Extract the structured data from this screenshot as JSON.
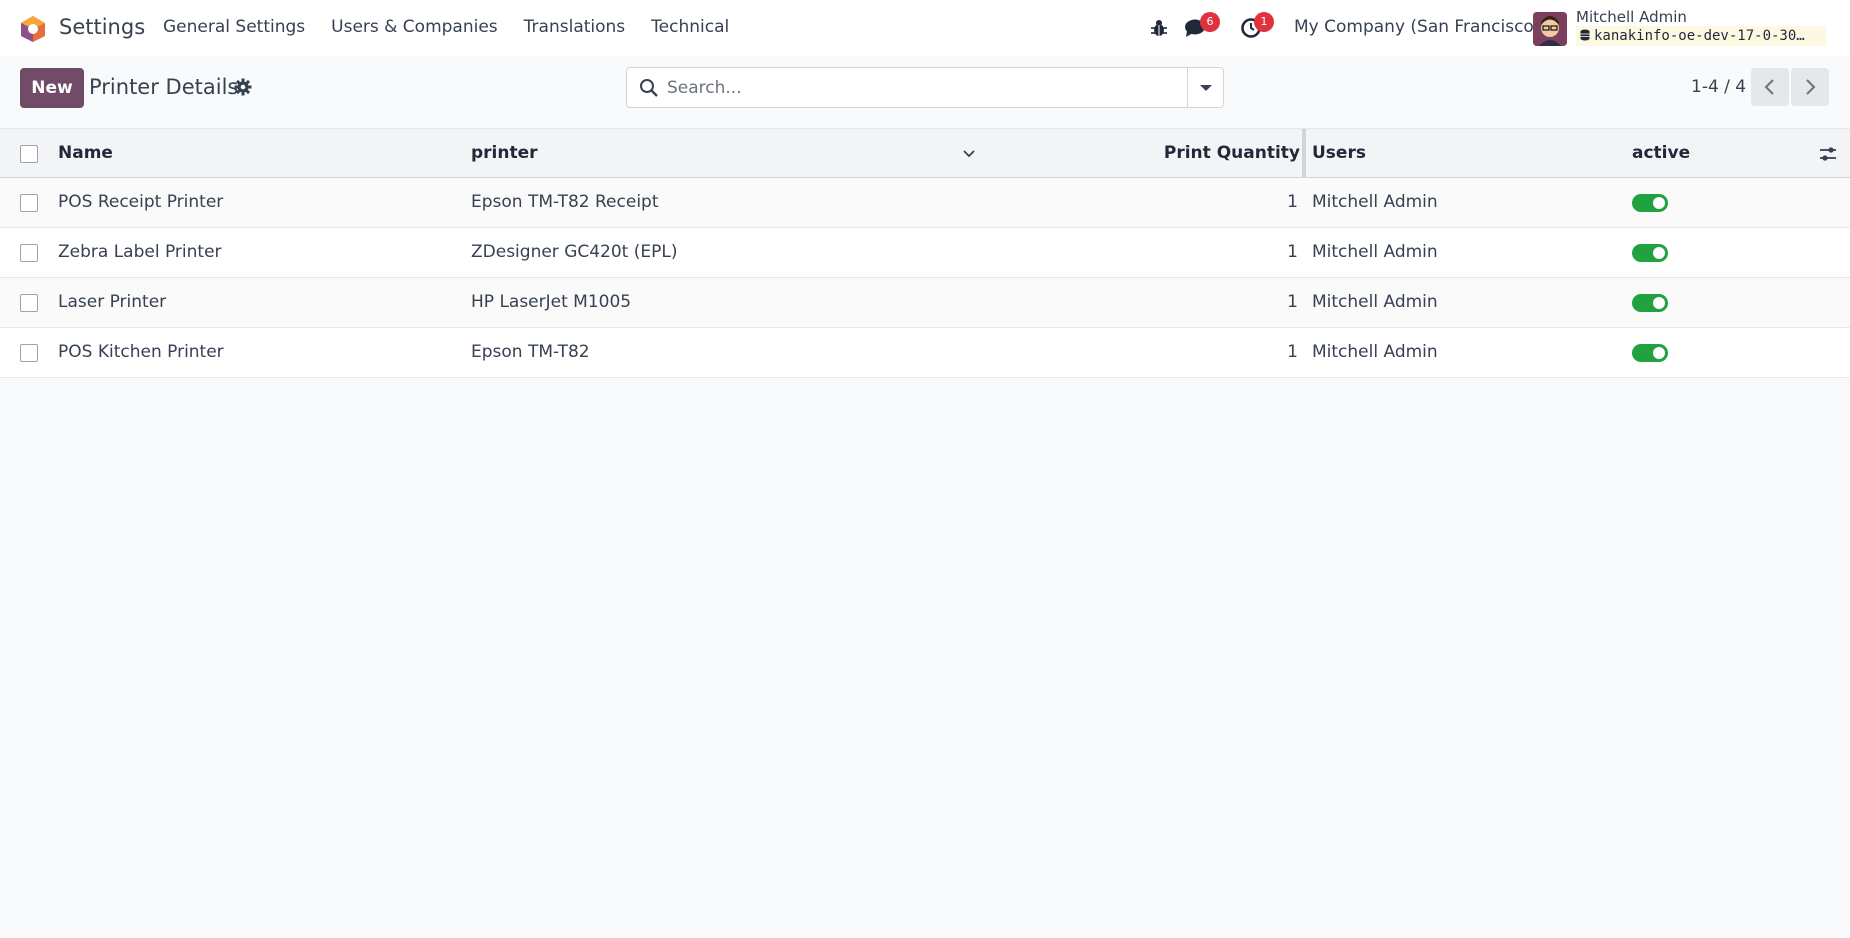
{
  "navbar": {
    "app_name": "Settings",
    "menu": [
      "General Settings",
      "Users & Companies",
      "Translations",
      "Technical"
    ],
    "messages_count": "6",
    "activities_count": "1",
    "company": "My Company (San Francisco)",
    "user_name": "Mitchell Admin",
    "database": "kanakinfo-oe-dev-17-0-30…"
  },
  "control_panel": {
    "new_label": "New",
    "title": "Printer Details",
    "search_placeholder": "Search...",
    "pager": "1-4 / 4"
  },
  "table": {
    "columns": [
      "Name",
      "printer",
      "Print Quantity",
      "Users",
      "active"
    ],
    "rows": [
      {
        "name": "POS Receipt Printer",
        "printer": "Epson TM-T82 Receipt",
        "qty": "1",
        "users": "Mitchell Admin",
        "active": true
      },
      {
        "name": "Zebra Label Printer",
        "printer": "ZDesigner GC420t (EPL)",
        "qty": "1",
        "users": "Mitchell Admin",
        "active": true
      },
      {
        "name": "Laser Printer",
        "printer": "HP LaserJet M1005",
        "qty": "1",
        "users": "Mitchell Admin",
        "active": true
      },
      {
        "name": "POS Kitchen Printer",
        "printer": "Epson TM-T82",
        "qty": "1",
        "users": "Mitchell Admin",
        "active": true
      }
    ]
  },
  "colors": {
    "brand": "#714b67",
    "toggle_on": "#21a240",
    "badge": "#e0323d"
  }
}
